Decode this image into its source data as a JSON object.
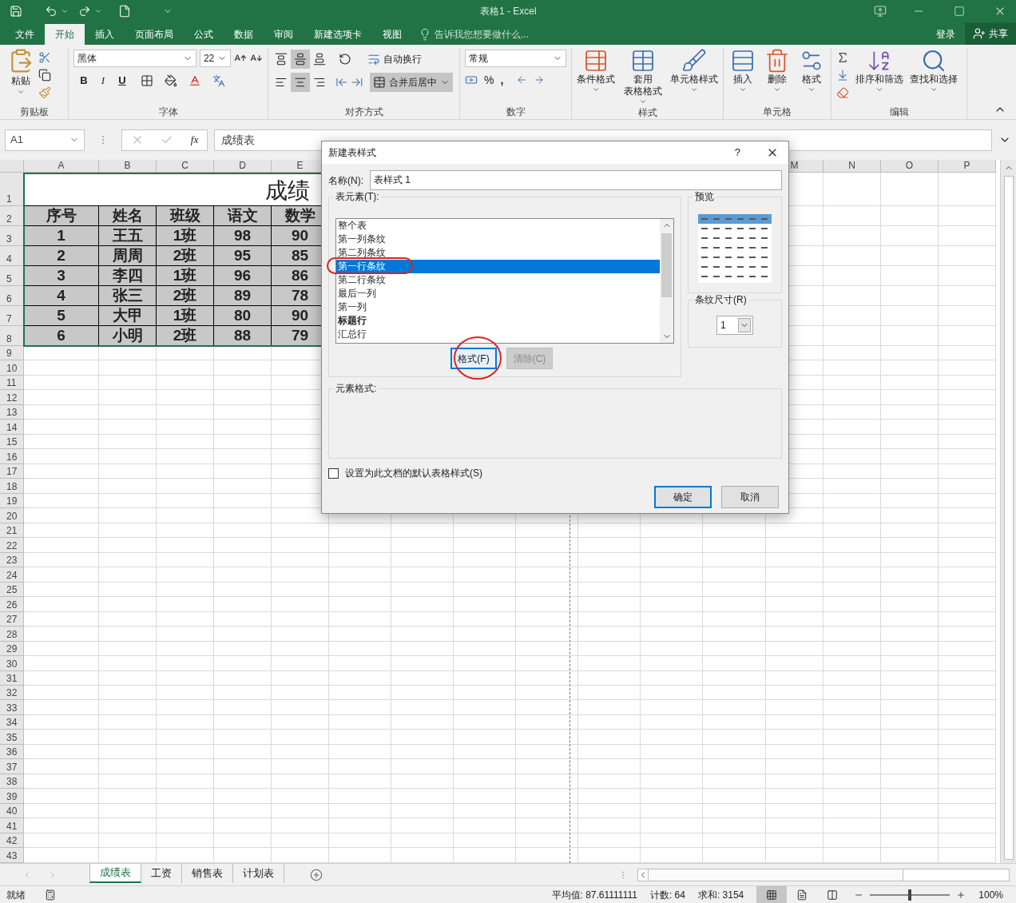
{
  "window": {
    "title": "表格1 - Excel"
  },
  "ribbon_tabs": [
    {
      "label": "文件",
      "selected": false
    },
    {
      "label": "开始",
      "selected": true
    },
    {
      "label": "插入",
      "selected": false
    },
    {
      "label": "页面布局",
      "selected": false
    },
    {
      "label": "公式",
      "selected": false
    },
    {
      "label": "数据",
      "selected": false
    },
    {
      "label": "审阅",
      "selected": false
    },
    {
      "label": "新建选项卡",
      "selected": false
    },
    {
      "label": "视图",
      "selected": false
    }
  ],
  "tell_me": {
    "placeholder": "告诉我您想要做什么..."
  },
  "account": {
    "sign_in": "登录",
    "share": "共享"
  },
  "clipboard": {
    "paste": "粘贴",
    "label": "剪贴板"
  },
  "font": {
    "name": "黑体",
    "size": "22",
    "styles": [
      "B",
      "I",
      "U"
    ],
    "label": "字体"
  },
  "alignment": {
    "wrap": "自动换行",
    "merge": "合并后居中",
    "label": "对齐方式"
  },
  "number": {
    "format": "常规",
    "percent": "%",
    "comma": ",",
    "label": "数字"
  },
  "styles": {
    "buttons": [
      {
        "lines": [
          "条件格式"
        ]
      },
      {
        "lines": [
          "套用",
          "表格格式"
        ]
      },
      {
        "lines": [
          "单元格样式"
        ]
      }
    ],
    "label": "样式"
  },
  "cells": {
    "buttons": [
      "插入",
      "删除",
      "格式"
    ],
    "label": "单元格"
  },
  "editing": {
    "buttons": [
      "排序和筛选",
      "查找和选择"
    ],
    "label": "编辑"
  },
  "formula_bar": {
    "name_box": "A1",
    "fx": "fx",
    "formula": "成绩表"
  },
  "sheet": {
    "columns": [
      "A",
      "B",
      "C",
      "D",
      "E",
      "M",
      "N",
      "O",
      "P"
    ],
    "rows": [
      "1",
      "2",
      "3",
      "4",
      "5",
      "6",
      "7",
      "8",
      "9",
      "10",
      "11",
      "12",
      "13",
      "14",
      "15",
      "16",
      "17",
      "18",
      "19",
      "20",
      "21",
      "22",
      "23",
      "24",
      "25",
      "26",
      "27",
      "28",
      "29",
      "30",
      "31",
      "32",
      "33",
      "34",
      "35",
      "36",
      "37",
      "38",
      "39",
      "40",
      "41",
      "42",
      "43"
    ],
    "table": {
      "title": "成绩",
      "header": [
        "序号",
        "姓名",
        "班级",
        "语文",
        "数学"
      ],
      "rows": [
        [
          "1",
          "王五",
          "1班",
          "98",
          "90"
        ],
        [
          "2",
          "周周",
          "2班",
          "95",
          "85"
        ],
        [
          "3",
          "李四",
          "1班",
          "96",
          "86"
        ],
        [
          "4",
          "张三",
          "2班",
          "89",
          "78"
        ],
        [
          "5",
          "大甲",
          "1班",
          "80",
          "90"
        ],
        [
          "6",
          "小明",
          "2班",
          "88",
          "79"
        ]
      ]
    }
  },
  "dialog": {
    "title": "新建表样式",
    "help": "?",
    "name_label": "名称(N):",
    "name_value": "表样式 1",
    "elements_label": "表元素(T):",
    "elements": [
      {
        "label": "整个表",
        "selected": false,
        "bold": false
      },
      {
        "label": "第一列条纹",
        "selected": false,
        "bold": false
      },
      {
        "label": "第二列条纹",
        "selected": false,
        "bold": false
      },
      {
        "label": "第一行条纹",
        "selected": true,
        "bold": false
      },
      {
        "label": "第二行条纹",
        "selected": false,
        "bold": false
      },
      {
        "label": "最后一列",
        "selected": false,
        "bold": false
      },
      {
        "label": "第一列",
        "selected": false,
        "bold": false
      },
      {
        "label": "标题行",
        "selected": false,
        "bold": true
      },
      {
        "label": "汇总行",
        "selected": false,
        "bold": false
      }
    ],
    "list_buttons": [
      {
        "label": "格式(F)",
        "disabled": false
      },
      {
        "label": "清除(C)",
        "disabled": true
      }
    ],
    "preview_label": "预览",
    "stripe_label": "条纹尺寸(R)",
    "stripe_value": "1",
    "element_format_label": "元素格式:",
    "default_checkbox": {
      "label": "设置为此文档的默认表格样式(S)",
      "checked": false
    },
    "ok": "确定",
    "cancel": "取消"
  },
  "sheet_tabs": [
    {
      "label": "成绩表",
      "selected": true
    },
    {
      "label": "工资",
      "selected": false
    },
    {
      "label": "销售表",
      "selected": false
    },
    {
      "label": "计划表",
      "selected": false
    }
  ],
  "status_bar": {
    "mode": "就绪",
    "average": "平均值: 87.61111111",
    "count": "计数: 64",
    "sum": "求和: 3154",
    "views": [
      {
        "kind": "normal",
        "selected": true
      },
      {
        "kind": "page_layout",
        "selected": false
      },
      {
        "kind": "page_break",
        "selected": false
      }
    ],
    "zoom_slider": {
      "level": 0.5
    },
    "zoom": "100%"
  }
}
